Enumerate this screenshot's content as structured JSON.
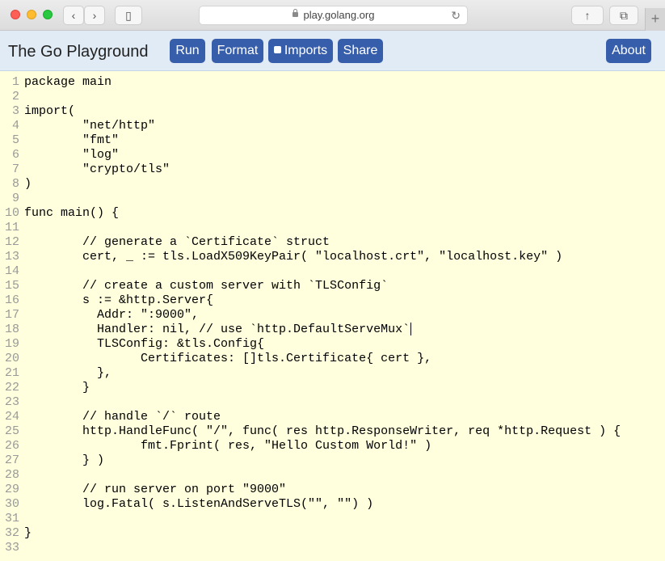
{
  "browser": {
    "url": "play.golang.org",
    "new_tab": "+"
  },
  "header": {
    "title": "The Go Playground",
    "run_label": "Run",
    "format_label": "Format",
    "imports_label": "Imports",
    "share_label": "Share",
    "about_label": "About"
  },
  "editor": {
    "lines": [
      {
        "n": "1",
        "text": "package main"
      },
      {
        "n": "2",
        "text": ""
      },
      {
        "n": "3",
        "text": "import("
      },
      {
        "n": "4",
        "text": "        \"net/http\""
      },
      {
        "n": "5",
        "text": "        \"fmt\""
      },
      {
        "n": "6",
        "text": "        \"log\""
      },
      {
        "n": "7",
        "text": "        \"crypto/tls\""
      },
      {
        "n": "8",
        "text": ")"
      },
      {
        "n": "9",
        "text": ""
      },
      {
        "n": "10",
        "text": "func main() {"
      },
      {
        "n": "11",
        "text": ""
      },
      {
        "n": "12",
        "text": "        // generate a `Certificate` struct"
      },
      {
        "n": "13",
        "text": "        cert, _ := tls.LoadX509KeyPair( \"localhost.crt\", \"localhost.key\" )"
      },
      {
        "n": "14",
        "text": ""
      },
      {
        "n": "15",
        "text": "        // create a custom server with `TLSConfig`"
      },
      {
        "n": "16",
        "text": "        s := &http.Server{"
      },
      {
        "n": "17",
        "text": "          Addr: \":9000\","
      },
      {
        "n": "18",
        "text": "          Handler: nil, // use `http.DefaultServeMux`"
      },
      {
        "n": "19",
        "text": "          TLSConfig: &tls.Config{"
      },
      {
        "n": "20",
        "text": "                Certificates: []tls.Certificate{ cert },"
      },
      {
        "n": "21",
        "text": "          },"
      },
      {
        "n": "22",
        "text": "        }"
      },
      {
        "n": "23",
        "text": ""
      },
      {
        "n": "24",
        "text": "        // handle `/` route"
      },
      {
        "n": "25",
        "text": "        http.HandleFunc( \"/\", func( res http.ResponseWriter, req *http.Request ) {"
      },
      {
        "n": "26",
        "text": "                fmt.Fprint( res, \"Hello Custom World!\" )"
      },
      {
        "n": "27",
        "text": "        } )"
      },
      {
        "n": "28",
        "text": ""
      },
      {
        "n": "29",
        "text": "        // run server on port \"9000\""
      },
      {
        "n": "30",
        "text": "        log.Fatal( s.ListenAndServeTLS(\"\", \"\") )"
      },
      {
        "n": "31",
        "text": ""
      },
      {
        "n": "32",
        "text": "}"
      },
      {
        "n": "33",
        "text": ""
      }
    ]
  }
}
